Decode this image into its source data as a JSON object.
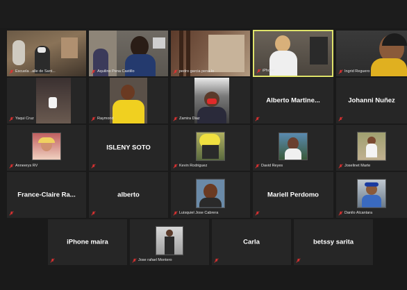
{
  "participants": [
    {
      "name": "Escuela ..alle de Sant..."
    },
    {
      "name": "Aquilino Pena Castillo"
    },
    {
      "name": "pedro garcia pena.lo"
    },
    {
      "name": "iPhone"
    },
    {
      "name": "Ingrid Reguero"
    },
    {
      "name": "Yaqui Cruz"
    },
    {
      "name": "Raymond"
    },
    {
      "name": "Zamira Diaz"
    },
    {
      "name": "Alberto Martine..."
    },
    {
      "name": "Johanni Nuñez"
    },
    {
      "name": "Anneerys RV"
    },
    {
      "name": "ISLENY SOTO"
    },
    {
      "name": "Kevin Rodriguez"
    },
    {
      "name": "David Reyes"
    },
    {
      "name": "Joselinet Marte"
    },
    {
      "name": "France-Claire Ra..."
    },
    {
      "name": "alberto"
    },
    {
      "name": "Luisquiel Jose Cabrera"
    },
    {
      "name": "Mariell Perdomo"
    },
    {
      "name": "Danilo Alcantara"
    },
    {
      "name": "iPhone maira"
    },
    {
      "name": "Jose rafael Montero"
    },
    {
      "name": "Carla"
    },
    {
      "name": "betssy sarita"
    }
  ],
  "colors": {
    "muted_icon": "#e03232",
    "active_speaker_border": "#dfe36a",
    "tile_bg": "#262626"
  }
}
